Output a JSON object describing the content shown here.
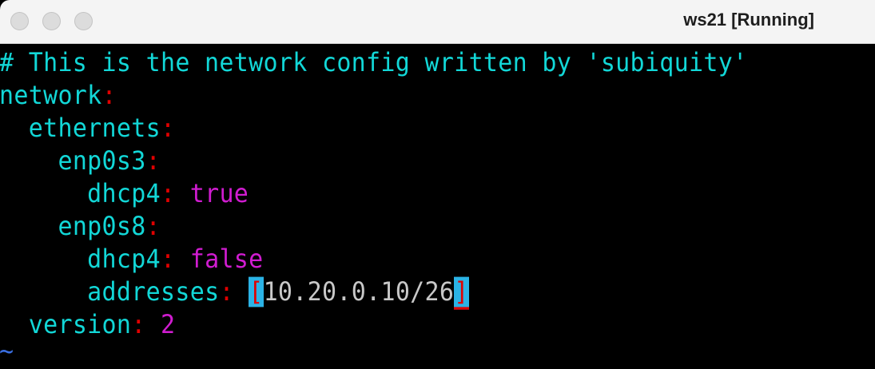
{
  "window": {
    "title": "ws21 [Running]"
  },
  "editor": {
    "lines": [
      {
        "indent": "",
        "key": "# This is the network config written by 'subiquity'"
      },
      {
        "indent": "",
        "key": "network",
        "colon": ":"
      },
      {
        "indent": "  ",
        "key": "ethernets",
        "colon": ":"
      },
      {
        "indent": "    ",
        "key": "enp0s3",
        "colon": ":"
      },
      {
        "indent": "      ",
        "key": "dhcp4",
        "colon": ":",
        "value": " true"
      },
      {
        "indent": "    ",
        "key": "enp0s8",
        "colon": ":"
      },
      {
        "indent": "      ",
        "key": "dhcp4",
        "colon": ":",
        "value": " false"
      },
      {
        "indent": "      ",
        "key": "addresses",
        "colon": ":",
        "space": " ",
        "open": "[",
        "value": "10.20.0.10/26",
        "close": "]"
      },
      {
        "indent": "  ",
        "key": "version",
        "colon": ":",
        "value": " 2"
      },
      {
        "indent": "",
        "key": "~"
      }
    ]
  },
  "colors": {
    "key": "#12d7d7",
    "colon": "#e00000",
    "value": "#d01cd0",
    "bracket_highlight": "#2bb3e6",
    "tilde": "#3a6ee0"
  }
}
